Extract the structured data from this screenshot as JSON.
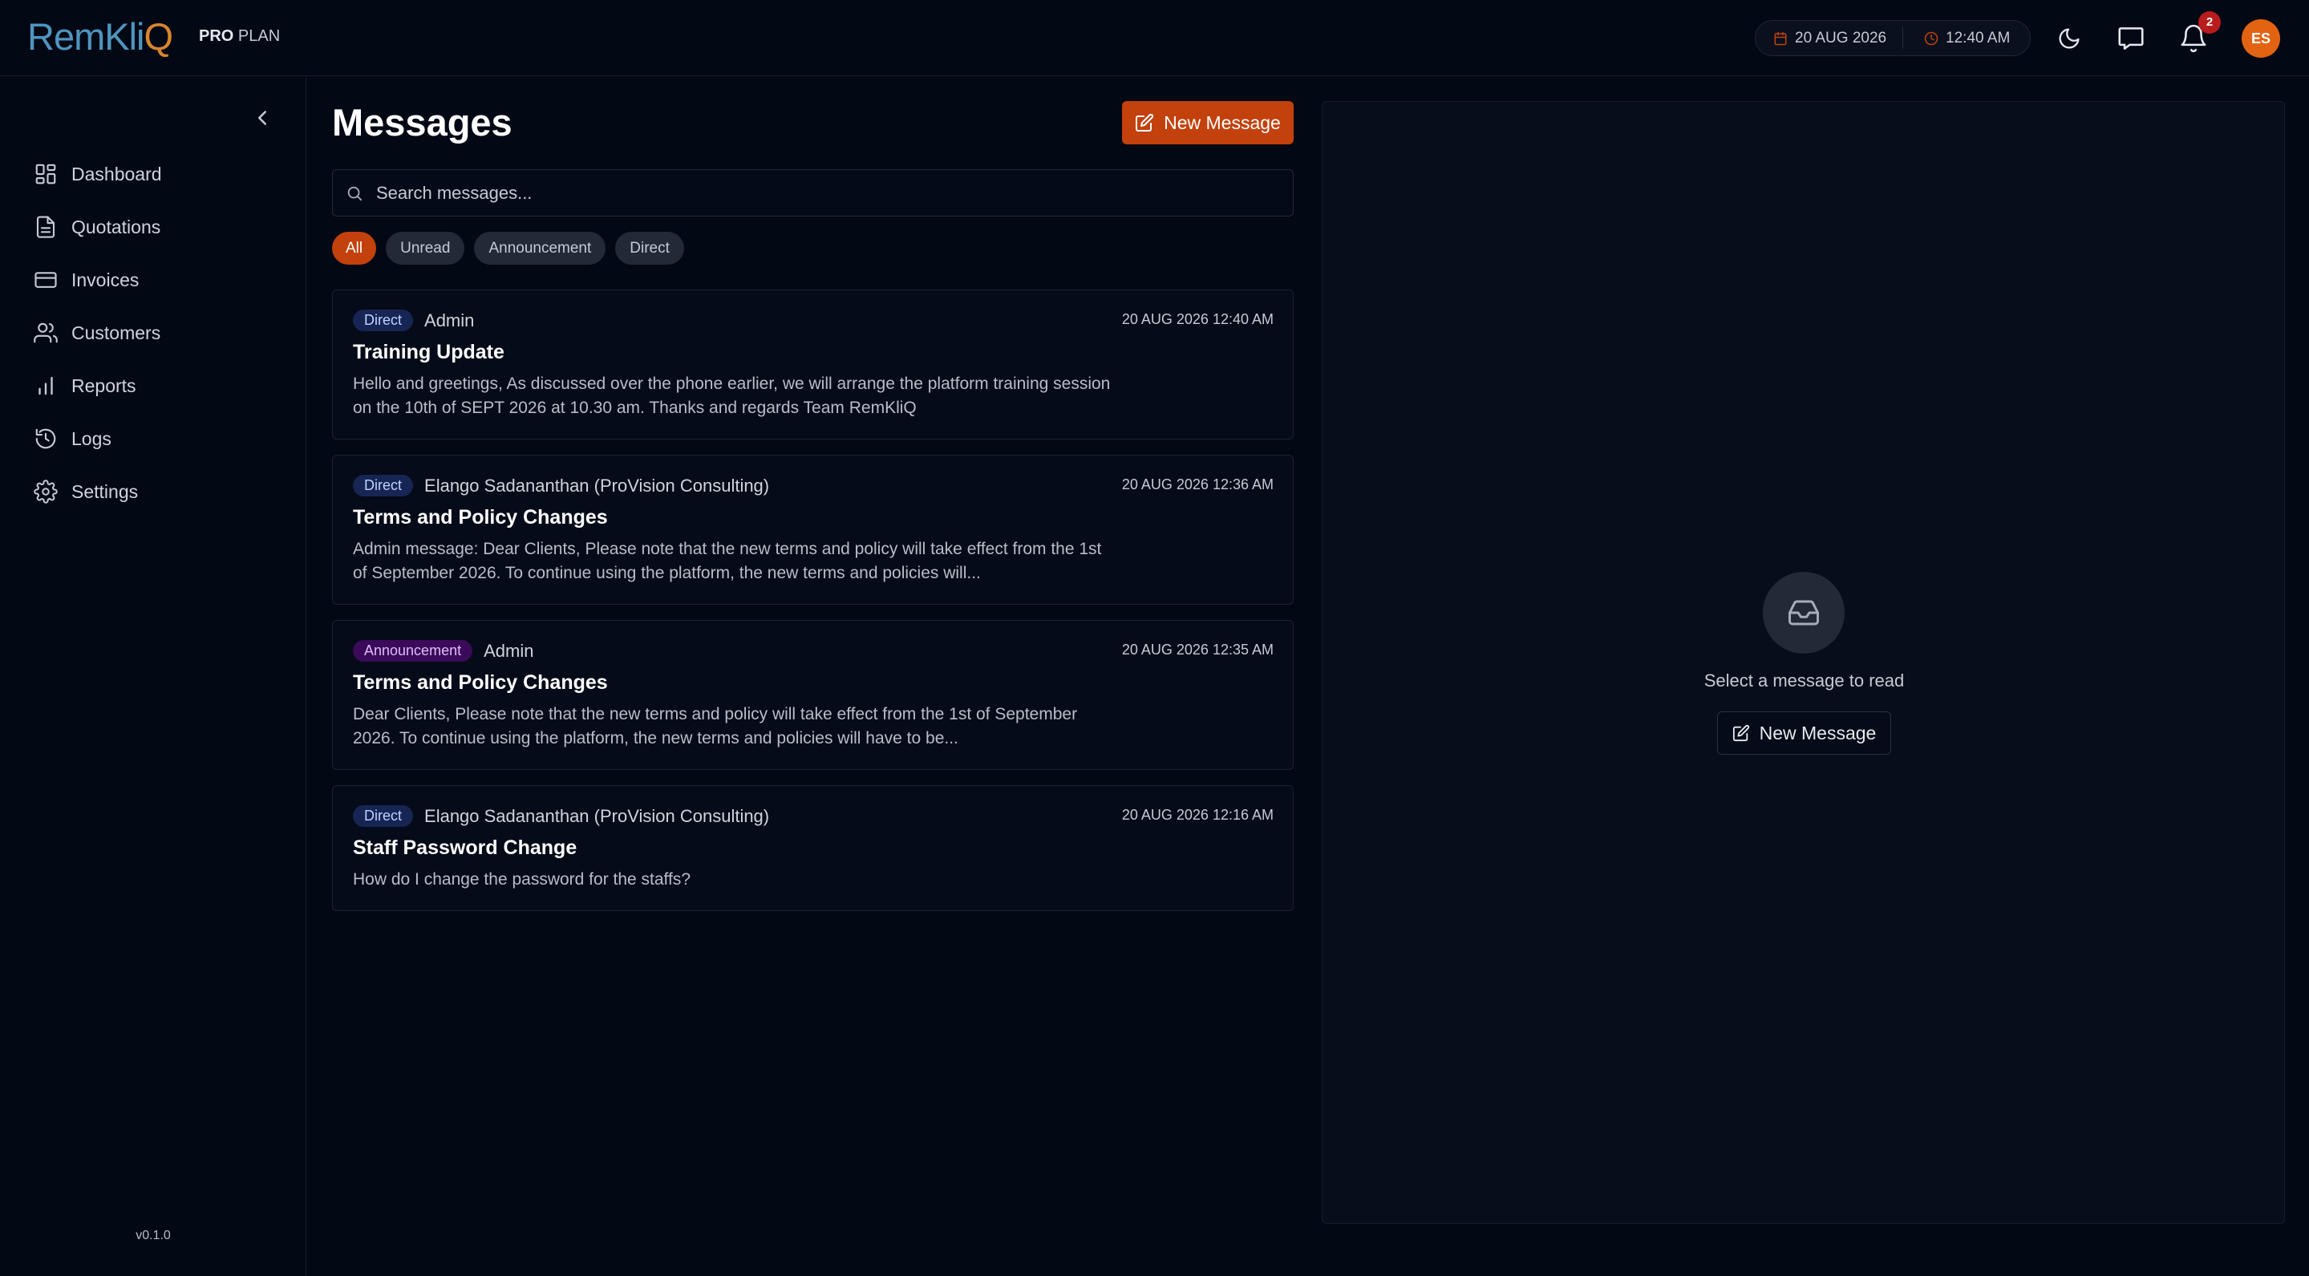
{
  "brand": {
    "logo_main": "RemKli",
    "logo_q": "Q",
    "plan_bold": "PRO",
    "plan_rest": "PLAN"
  },
  "header": {
    "date": "20 AUG 2026",
    "time": "12:40 AM",
    "notification_count": "2",
    "avatar_initials": "ES"
  },
  "sidebar": {
    "items": [
      {
        "label": "Dashboard",
        "icon": "dashboard-icon"
      },
      {
        "label": "Quotations",
        "icon": "document-icon"
      },
      {
        "label": "Invoices",
        "icon": "card-icon"
      },
      {
        "label": "Customers",
        "icon": "users-icon"
      },
      {
        "label": "Reports",
        "icon": "bar-chart-icon"
      },
      {
        "label": "Logs",
        "icon": "history-icon"
      },
      {
        "label": "Settings",
        "icon": "gear-icon"
      }
    ],
    "version": "v0.1.0"
  },
  "main": {
    "title": "Messages",
    "new_message_label": "New Message",
    "search_placeholder": "Search messages...",
    "filters": [
      "All",
      "Unread",
      "Announcement",
      "Direct"
    ],
    "messages": [
      {
        "tag": "Direct",
        "sender": "Admin",
        "time": "20 AUG 2026 12:40 AM",
        "subject": "Training Update",
        "preview": "Hello and greetings, As discussed over the phone earlier, we will arrange the platform training session on the 10th of SEPT 2026 at 10.30 am. Thanks and regards Team RemKliQ"
      },
      {
        "tag": "Direct",
        "sender": "Elango Sadananthan (ProVision Consulting)",
        "time": "20 AUG 2026 12:36 AM",
        "subject": "Terms and Policy Changes",
        "preview": "Admin message: Dear Clients, Please note that the new terms and policy will take effect from the 1st of September 2026. To continue using the platform, the new terms and policies will..."
      },
      {
        "tag": "Announcement",
        "sender": "Admin",
        "time": "20 AUG 2026 12:35 AM",
        "subject": "Terms and Policy Changes",
        "preview": "Dear Clients, Please note that the new terms and policy will take effect from the 1st of September 2026. To continue using the platform, the new terms and policies will have to be..."
      },
      {
        "tag": "Direct",
        "sender": "Elango Sadananthan (ProVision Consulting)",
        "time": "20 AUG 2026 12:16 AM",
        "subject": "Staff Password Change",
        "preview": "How do I change the password for the staffs?"
      }
    ]
  },
  "detail": {
    "empty_text": "Select a message to read",
    "new_message_label": "New Message"
  },
  "colors": {
    "accent": "#c2410c",
    "background": "#030815",
    "logo_blue": "#4f95be",
    "logo_orange": "#d7852e"
  }
}
